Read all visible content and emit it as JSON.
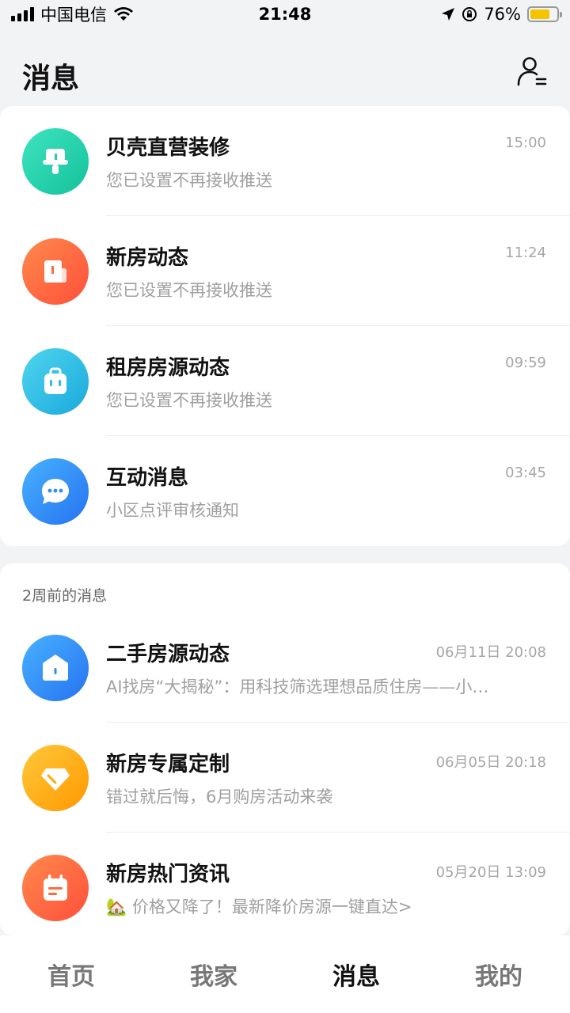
{
  "status_bar": {
    "carrier": "中国电信",
    "time": "21:48",
    "battery": "76%"
  },
  "header": {
    "title": "消息"
  },
  "recent": [
    {
      "title": "贝壳直营装修",
      "time": "15:00",
      "preview": "您已设置不再接收推送",
      "icon": "paint-roller-icon",
      "color": "#1fcfa6"
    },
    {
      "title": "新房动态",
      "time": "11:24",
      "preview": "您已设置不再接收推送",
      "icon": "building-icon",
      "color": "#ff6a3d"
    },
    {
      "title": "租房房源动态",
      "time": "09:59",
      "preview": "您已设置不再接收推送",
      "icon": "bag-icon",
      "color": "#2bbfe3"
    },
    {
      "title": "互动消息",
      "time": "03:45",
      "preview": "小区点评审核通知",
      "icon": "chat-bubble-icon",
      "color": "#2b8cf5"
    }
  ],
  "older": {
    "section_title": "2周前的消息",
    "items": [
      {
        "title": "二手房源动态",
        "time": "06月11日 20:08",
        "preview": "AI找房“大揭秘”：用科技筛选理想品质住房——小…",
        "icon": "house-icon",
        "color": "#2b8cf5"
      },
      {
        "title": "新房专属定制",
        "time": "06月05日 20:18",
        "preview": "错过就后悔，6月购房活动来袭",
        "icon": "diamond-icon",
        "color": "#ffab00"
      },
      {
        "title": "新房热门资讯",
        "time": "05月20日 13:09",
        "preview": "🏡 价格又降了！最新降价房源一键直达>",
        "icon": "calendar-icon",
        "color": "#ff6a3d"
      }
    ]
  },
  "tabs": [
    {
      "label": "首页",
      "active": false
    },
    {
      "label": "我家",
      "active": false
    },
    {
      "label": "消息",
      "active": true
    },
    {
      "label": "我的",
      "active": false
    }
  ]
}
